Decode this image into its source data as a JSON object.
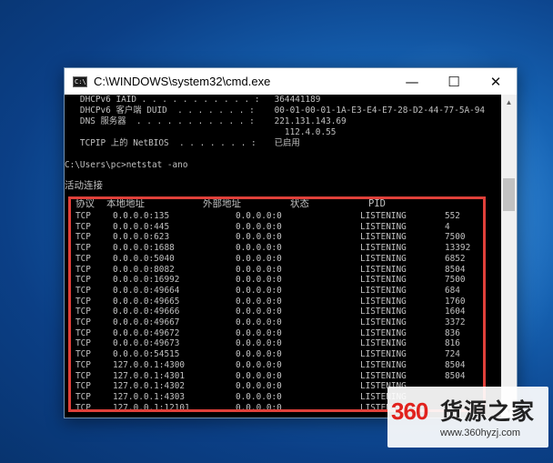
{
  "window": {
    "title": "C:\\WINDOWS\\system32\\cmd.exe",
    "icon_text": "C:\\",
    "icon": "cmd-icon",
    "minimize_glyph": "—",
    "maximize_glyph": "☐",
    "close_glyph": "✕",
    "scroll_up_glyph": "▲",
    "scroll_down_glyph": "▼"
  },
  "console": {
    "ipconfig_lines": [
      {
        "key": "   DHCPv6 IAID . . . . . . . . . . . :",
        "value": " 364441189"
      },
      {
        "key": "   DHCPv6 客户端 DUID  . . . . . . . :",
        "value": " 00-01-00-01-1A-E3-E4-E7-28-D2-44-77-5A-94"
      },
      {
        "key": "   DNS 服务器  . . . . . . . . . . . :",
        "value": " 221.131.143.69"
      },
      {
        "key": "",
        "value": "   112.4.0.55"
      },
      {
        "key": "   TCPIP 上的 NetBIOS  . . . . . . . :",
        "value": " 已启用"
      }
    ],
    "prompt": "C:\\Users\\pc>netstat -ano",
    "section_title": "活动连接",
    "headers": [
      "协议",
      "本地地址",
      "外部地址",
      "状态",
      "PID"
    ],
    "rows": [
      [
        "TCP",
        "0.0.0.0:135",
        "0.0.0.0:0",
        "LISTENING",
        "552"
      ],
      [
        "TCP",
        "0.0.0.0:445",
        "0.0.0.0:0",
        "LISTENING",
        "4"
      ],
      [
        "TCP",
        "0.0.0.0:623",
        "0.0.0.0:0",
        "LISTENING",
        "7500"
      ],
      [
        "TCP",
        "0.0.0.0:1688",
        "0.0.0.0:0",
        "LISTENING",
        "13392"
      ],
      [
        "TCP",
        "0.0.0.0:5040",
        "0.0.0.0:0",
        "LISTENING",
        "6852"
      ],
      [
        "TCP",
        "0.0.0.0:8082",
        "0.0.0.0:0",
        "LISTENING",
        "8504"
      ],
      [
        "TCP",
        "0.0.0.0:16992",
        "0.0.0.0:0",
        "LISTENING",
        "7500"
      ],
      [
        "TCP",
        "0.0.0.0:49664",
        "0.0.0.0:0",
        "LISTENING",
        "684"
      ],
      [
        "TCP",
        "0.0.0.0:49665",
        "0.0.0.0:0",
        "LISTENING",
        "1760"
      ],
      [
        "TCP",
        "0.0.0.0:49666",
        "0.0.0.0:0",
        "LISTENING",
        "1604"
      ],
      [
        "TCP",
        "0.0.0.0:49667",
        "0.0.0.0:0",
        "LISTENING",
        "3372"
      ],
      [
        "TCP",
        "0.0.0.0:49672",
        "0.0.0.0:0",
        "LISTENING",
        "836"
      ],
      [
        "TCP",
        "0.0.0.0:49673",
        "0.0.0.0:0",
        "LISTENING",
        "816"
      ],
      [
        "TCP",
        "0.0.0.0:54515",
        "0.0.0.0:0",
        "LISTENING",
        "724"
      ],
      [
        "TCP",
        "127.0.0.1:4300",
        "0.0.0.0:0",
        "LISTENING",
        "8504"
      ],
      [
        "TCP",
        "127.0.0.1:4301",
        "0.0.0.0:0",
        "LISTENING",
        "8504"
      ],
      [
        "TCP",
        "127.0.0.1:4302",
        "0.0.0.0:0",
        "LISTENING",
        ""
      ],
      [
        "TCP",
        "127.0.0.1:4303",
        "0.0.0.0:0",
        "LISTENING",
        ""
      ],
      [
        "TCP",
        "127.0.0.1:12101",
        "0.0.0.0:0",
        "LISTENING",
        ""
      ]
    ]
  },
  "watermark": {
    "badge_text": "360",
    "brand": "货源之家",
    "url": "www.360hyzj.com"
  },
  "colors": {
    "console_text": "#c0c0c0",
    "highlight_box": "#e0403a",
    "brand_red": "#e1221d"
  }
}
